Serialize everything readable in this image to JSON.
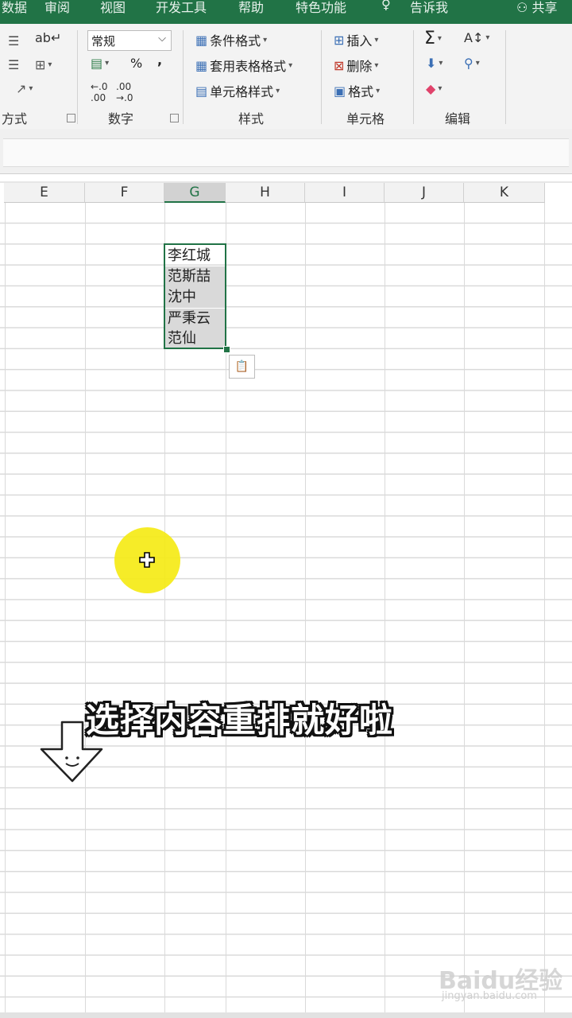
{
  "tabs": [
    "数据",
    "审阅",
    "视图",
    "开发工具",
    "帮助",
    "特色功能",
    "告诉我",
    "共享"
  ],
  "ribbon": {
    "alignment": {
      "label": "方式"
    },
    "number": {
      "label": "数字",
      "format_value": "常规",
      "percent": "%",
      "comma": ","
    },
    "styles": {
      "label": "样式",
      "conditional": "条件格式",
      "table": "套用表格格式",
      "cell_style": "单元格样式"
    },
    "cells": {
      "label": "单元格",
      "insert": "插入",
      "delete": "删除",
      "format": "格式"
    },
    "editing": {
      "label": "编辑"
    }
  },
  "columns": [
    "E",
    "F",
    "G",
    "H",
    "I",
    "J",
    "K"
  ],
  "selected_column": "G",
  "cells": [
    "李红城",
    "范斯喆",
    "沈中",
    "严秉云",
    "范仙"
  ],
  "caption": "选择内容重排就好啦",
  "watermark": {
    "brand": "Baidu经验",
    "url": "jingyan.baidu.com"
  },
  "colors": {
    "accent": "#217346",
    "highlight": "#f5ea16"
  }
}
